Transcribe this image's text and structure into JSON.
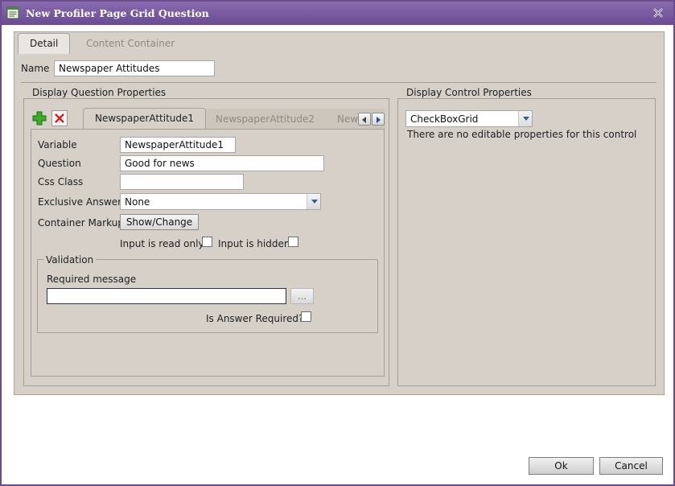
{
  "window": {
    "title": "New Profiler Page Grid Question"
  },
  "tabs": {
    "detail": "Detail",
    "content_container": "Content Container"
  },
  "name_field": {
    "label": "Name",
    "value": "Newspaper Attitudes"
  },
  "display_question": {
    "legend": "Display Question Properties",
    "question_tabs": [
      "NewspaperAttitude1",
      "NewspaperAttitude2",
      "Newsp"
    ],
    "variable_label": "Variable",
    "variable_value": "NewspaperAttitude1",
    "question_label": "Question",
    "question_value": "Good for news",
    "css_class_label": "Css Class",
    "css_class_value": "",
    "exclusive_answer_label": "Exclusive Answer",
    "exclusive_answer_value": "None",
    "container_markup_label": "Container Markup",
    "show_change_label": "Show/Change",
    "read_only_label": "Input is read only",
    "hidden_label": "Input is hidden",
    "validation": {
      "legend": "Validation",
      "required_message_label": "Required message",
      "required_message_value": "",
      "ellipsis_label": "...",
      "is_required_label": "Is Answer Required?"
    }
  },
  "display_control": {
    "legend": "Display Control Properties",
    "control_value": "CheckBoxGrid",
    "no_props_text": "There are no editable properties for this control"
  },
  "buttons": {
    "ok": "Ok",
    "cancel": "Cancel"
  },
  "colors": {
    "titlebar": "#6a4a92",
    "panel": "#d6d0c8",
    "add_icon": "#3cab2a",
    "delete_icon": "#d42020"
  }
}
